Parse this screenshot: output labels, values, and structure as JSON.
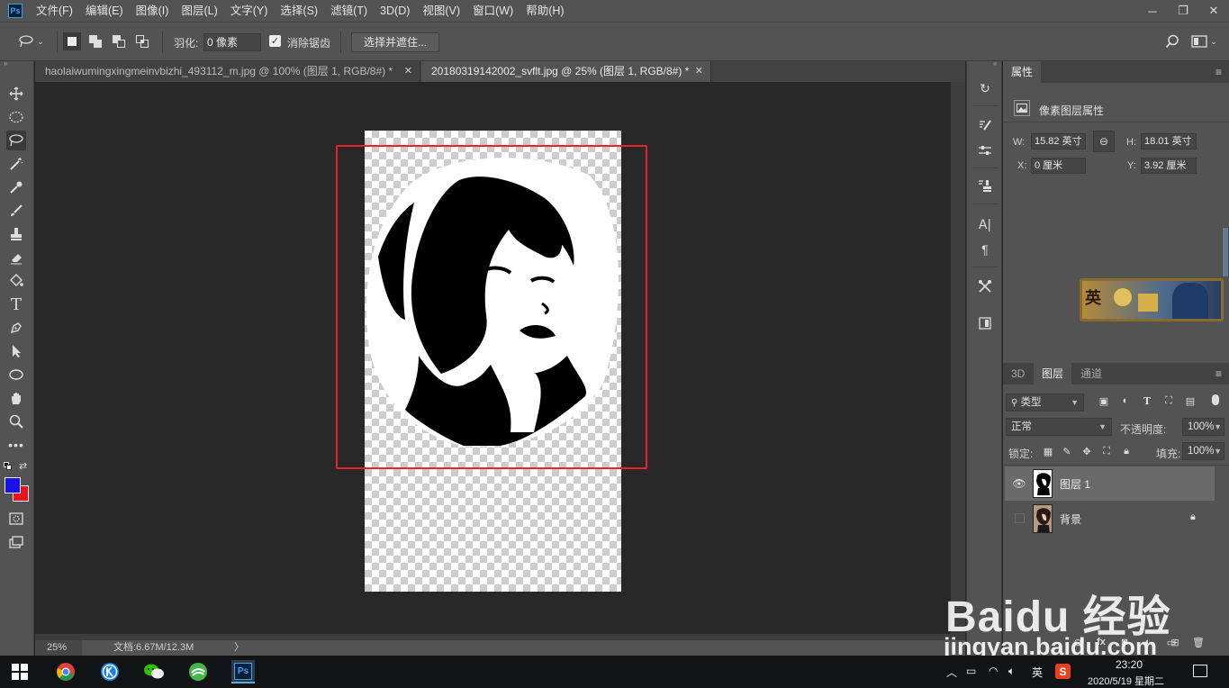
{
  "app": {
    "logo": "Ps"
  },
  "menu": [
    "文件(F)",
    "编辑(E)",
    "图像(I)",
    "图层(L)",
    "文字(Y)",
    "选择(S)",
    "滤镜(T)",
    "3D(D)",
    "视图(V)",
    "窗口(W)",
    "帮助(H)"
  ],
  "options": {
    "feather_label": "羽化:",
    "feather_value": "0 像素",
    "antialias_label": "消除锯齿",
    "antialias_checked": true,
    "select_mask_label": "选择并遮住..."
  },
  "tabs": [
    {
      "label": "haolaiwumingxingmeinvbizhi_493112_m.jpg @ 100% (图层 1, RGB/8#) *",
      "active": false
    },
    {
      "label": "20180319142002_svflt.jpg @ 25% (图层 1, RGB/8#) *",
      "active": true
    }
  ],
  "status": {
    "zoom": "25%",
    "doc_info": "文档:6.67M/12.3M",
    "arrow": "〉"
  },
  "colors": {
    "foreground": "#1a10e8",
    "background": "#e8141c",
    "selection_box": "#e8232a"
  },
  "properties": {
    "tab": "属性",
    "section": "像素图层属性",
    "w_label": "W:",
    "w_value": "15.82 英寸",
    "h_label": "H:",
    "h_value": "18.01 英寸",
    "x_label": "X:",
    "x_value": "0 厘米",
    "y_label": "Y:",
    "y_value": "3.92 厘米"
  },
  "layers_panel": {
    "tabs": [
      "3D",
      "图层",
      "通道"
    ],
    "filter_label": "类型",
    "blend_mode": "正常",
    "opacity_label": "不透明度:",
    "opacity_value": "100%",
    "lock_label": "锁定:",
    "fill_label": "填充:",
    "fill_value": "100%",
    "layers": [
      {
        "name": "图层 1",
        "visible": true,
        "selected": true
      },
      {
        "name": "背景",
        "visible": false,
        "selected": false,
        "locked": true
      }
    ]
  },
  "banner": {
    "text": "英"
  },
  "watermark": {
    "main": "Baidu 经验",
    "sub": "jingyan.baidu.com"
  },
  "taskbar": {
    "tray_ime": "英",
    "time": "23:20",
    "date": "2020/5/19 星期二"
  }
}
